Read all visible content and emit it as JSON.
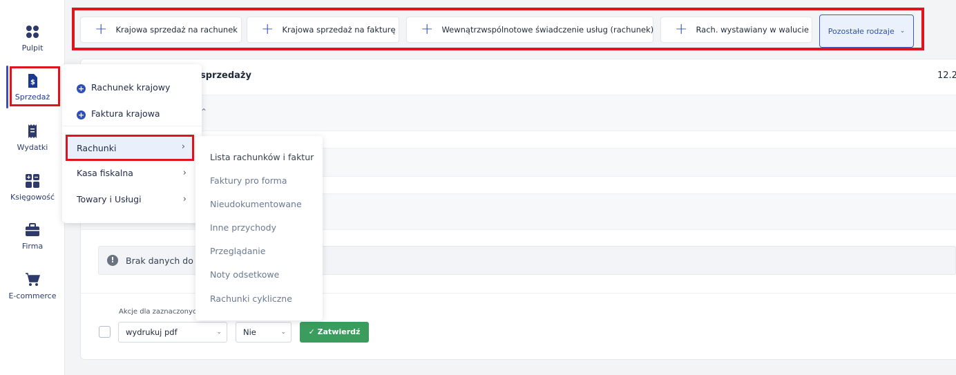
{
  "sidebar": {
    "items": [
      {
        "label": "Pulpit",
        "icon": "dashboard-icon"
      },
      {
        "label": "Sprzedaż",
        "icon": "invoice-dollar-icon"
      },
      {
        "label": "Wydatki",
        "icon": "receipt-icon"
      },
      {
        "label": "Księgowość",
        "icon": "calculator-icon"
      },
      {
        "label": "Firma",
        "icon": "briefcase-icon"
      },
      {
        "label": "E-commerce",
        "icon": "cart-icon"
      }
    ]
  },
  "toolbar": {
    "buttons": [
      {
        "label": "Krajowa sprzedaż na rachunek"
      },
      {
        "label": "Krajowa sprzedaż na fakturę"
      },
      {
        "label": "Wewnątrzwspólnotowe  świadczenie usług (rachunek)"
      },
      {
        "label": "Rach. wystawiany w walucie"
      }
    ],
    "more_label": "Pozostałe rodzaje"
  },
  "main": {
    "title_partial": "sprzedaży",
    "date_partial": "12.2",
    "info_text": "Brak danych do w",
    "actions_label": "Akcje dla zaznaczonyc",
    "action_select_value": "wydrukuj pdf",
    "option_select_value": "Nie",
    "confirm_label": "Zatwierdź"
  },
  "menu": {
    "add_items": [
      "Rachunek krajowy",
      "Faktura krajowa"
    ],
    "groups": [
      "Rachunki",
      "Kasa fiskalna",
      "Towary i Usługi"
    ]
  },
  "submenu": {
    "items": [
      "Lista rachunków i faktur",
      "Faktury pro forma",
      "Nieudokumentowane",
      "Inne przychody",
      "Przeglądanie",
      "Noty odsetkowe",
      "Rachunki cykliczne"
    ]
  },
  "colors": {
    "accent": "#2f4fb8",
    "highlight": "#e0141e",
    "confirm": "#3a9d5d"
  }
}
